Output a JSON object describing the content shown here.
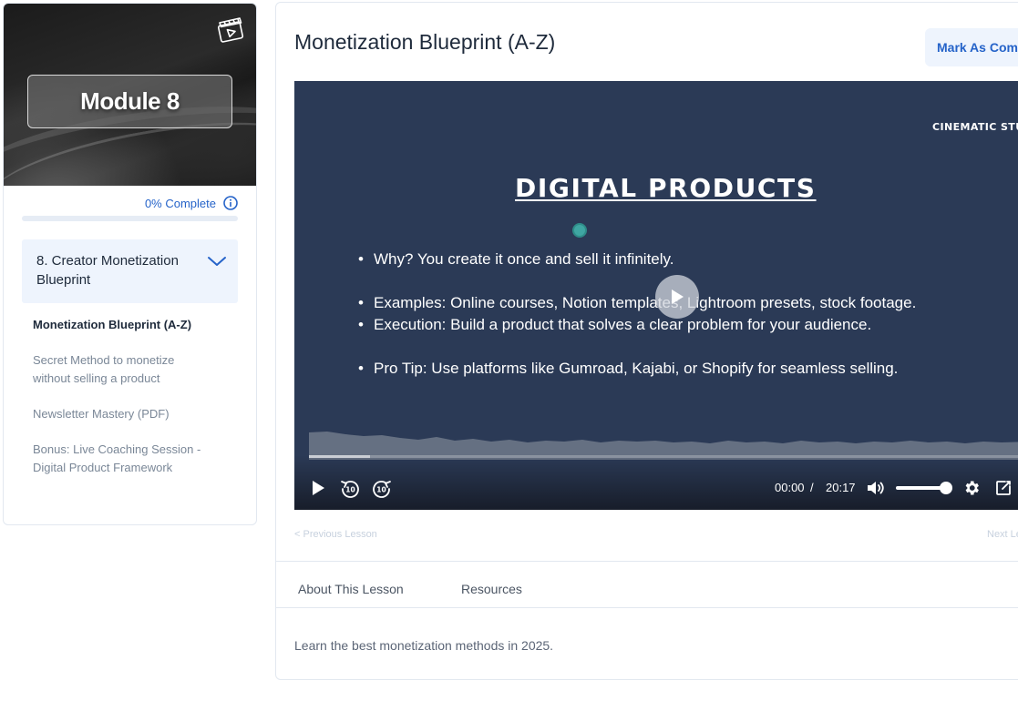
{
  "sidebar": {
    "module_label": "Module 8",
    "progress_text": "0% Complete",
    "progress_fraction": 0,
    "chapter_title": "8. Creator Monetization Blueprint",
    "lessons": [
      {
        "label": "Monetization Blueprint (A-Z)",
        "active": true
      },
      {
        "label": "Secret Method to monetize without selling a product",
        "active": false
      },
      {
        "label": "Newsletter Mastery (PDF)",
        "active": false
      },
      {
        "label": "Bonus: Live Coaching Session - Digital Product Framework",
        "active": false
      }
    ]
  },
  "main": {
    "title": "Monetization Blueprint (A-Z)",
    "mark_complete_label": "Mark As Complete",
    "video": {
      "studio_label": "CINEMATIC STUDIO",
      "slide_heading": "DIGITAL PRODUCTS",
      "bullets": [
        "Why? You create it once and sell it infinitely.",
        "Examples: Online courses, Notion templates, Lightroom presets, stock footage.",
        "Execution: Build a product that solves a clear problem for your audience.",
        "Pro Tip: Use platforms like Gumroad, Kajabi, or Shopify for seamless selling."
      ],
      "current_time": "00:00",
      "time_separator": "/",
      "duration": "20:17",
      "volume_fraction": 0.9,
      "buffered_fraction": 0.085
    },
    "prev_label": "< Previous Lesson",
    "next_label": "Next Lesson >",
    "tabs": [
      {
        "label": "About This Lesson"
      },
      {
        "label": "Resources"
      }
    ],
    "description": "Learn the best monetization methods in 2025."
  },
  "colors": {
    "accent": "#2563c9",
    "chapter_bg": "#eef4fd",
    "video_bg": "#2b3a56"
  },
  "icons": {
    "module_thumbnail": "video-clapper-icon",
    "progress_info": "info-icon",
    "chapter_toggle": "chevron-down-icon",
    "play": "play-icon",
    "rewind": "rewind-10-icon",
    "forward": "forward-10-icon",
    "volume": "volume-icon",
    "settings": "gear-icon",
    "fullscreen": "external-link-icon"
  }
}
